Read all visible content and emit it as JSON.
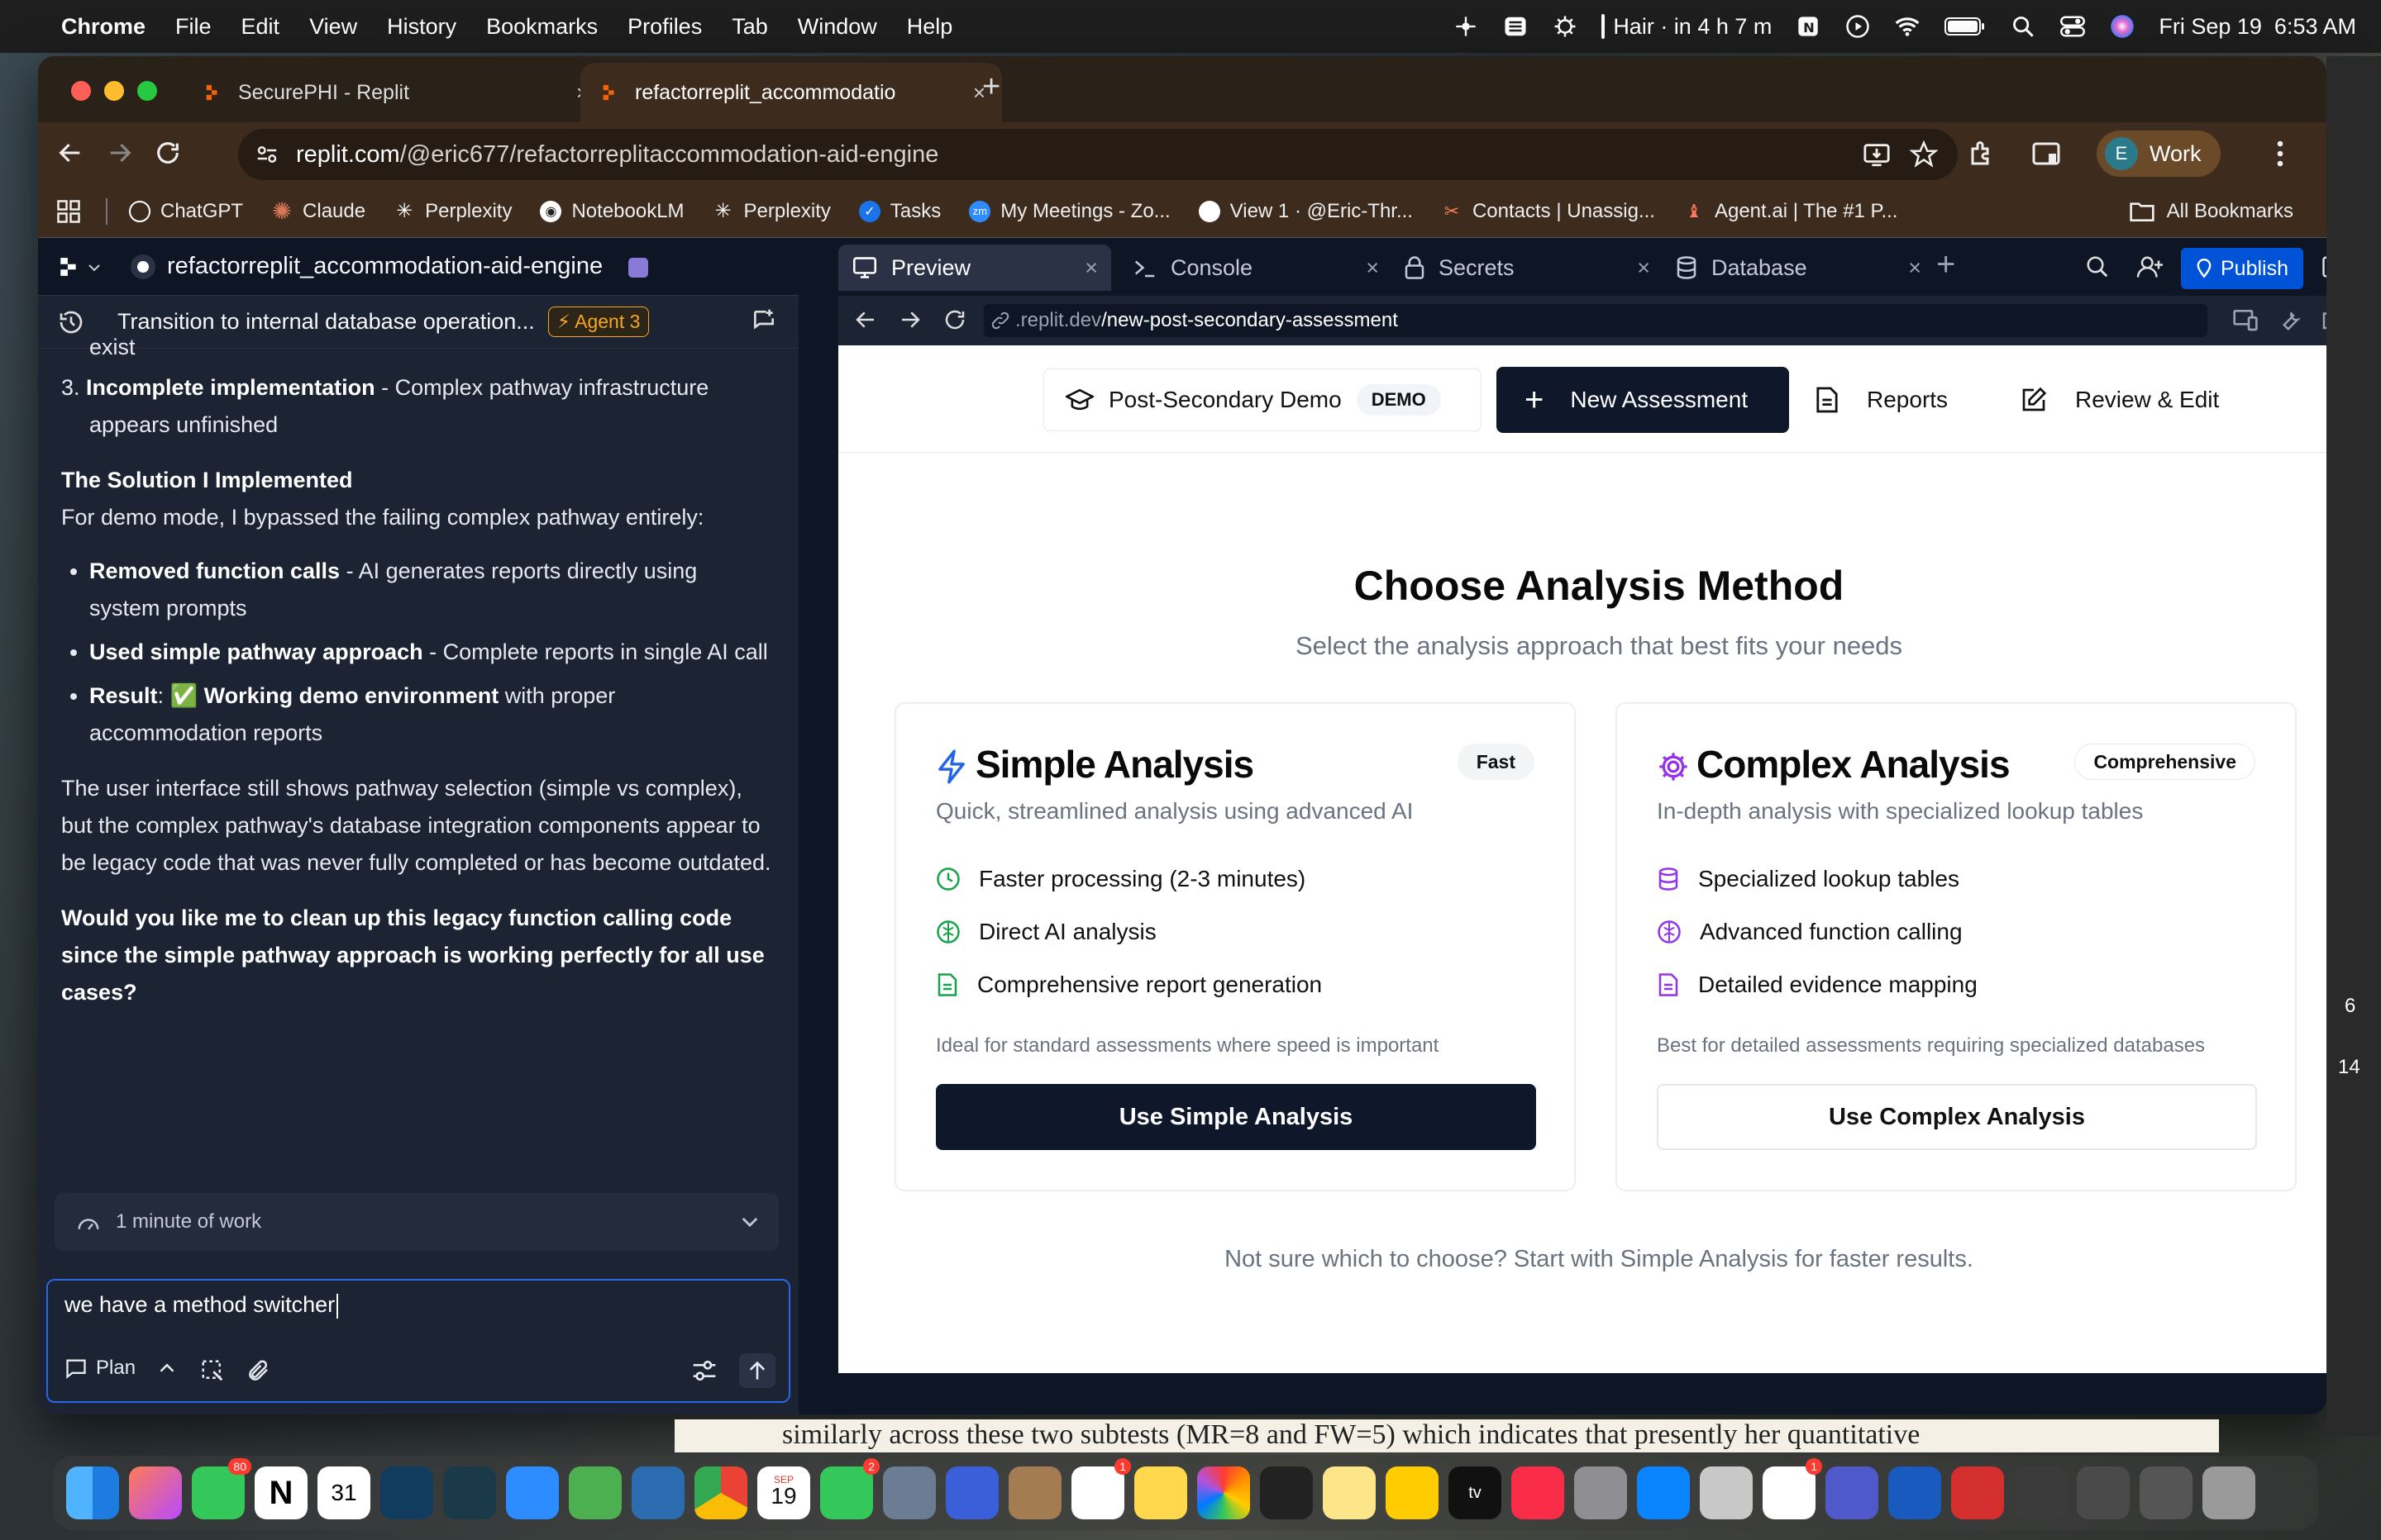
{
  "menubar": {
    "app": "Chrome",
    "items": [
      "File",
      "Edit",
      "View",
      "History",
      "Bookmarks",
      "Profiles",
      "Tab",
      "Window",
      "Help"
    ],
    "status_text": "Hair · in 4 h 7 m",
    "datetime": "Fri Sep 19  6:53 AM"
  },
  "browser": {
    "tabs": [
      {
        "label": "SecurePHI - Replit",
        "active": false
      },
      {
        "label": "refactorreplit_accommodatio",
        "active": true
      }
    ],
    "new_tab": "+",
    "tab_close": "×",
    "url_host": "replit.com",
    "url_path": "/@eric677/refactorreplitaccommodation-aid-engine",
    "profile_initial": "E",
    "profile_label": "Work",
    "bookmarks": [
      {
        "label": "ChatGPT",
        "color": "#ffffff"
      },
      {
        "label": "Claude",
        "color": "#d97757"
      },
      {
        "label": "Perplexity",
        "color": "#ffffff"
      },
      {
        "label": "NotebookLM",
        "color": "#ffffff"
      },
      {
        "label": "Perplexity",
        "color": "#ffffff"
      },
      {
        "label": "Tasks",
        "color": "#1a73e8"
      },
      {
        "label": "My Meetings - Zo...",
        "color": "#2d8cff"
      },
      {
        "label": "View 1 · @Eric-Thr...",
        "color": "#ffffff"
      },
      {
        "label": "Contacts | Unassig...",
        "color": "#ff7a59"
      },
      {
        "label": "Agent.ai | The #1 P...",
        "color": "#ff7a59"
      }
    ],
    "all_bookmarks": "All Bookmarks"
  },
  "replit": {
    "repl_name": "refactorreplit_accommodation-aid-engine",
    "chat_title": "Transition to internal database operation...",
    "agent_badge": "Agent 3",
    "chat": {
      "line_exist": "exist",
      "item3_bold": "Incomplete implementation",
      "item3_rest": " - Complex pathway infrastructure appears unfinished",
      "item3_num": "3.",
      "solution_heading": "The Solution I Implemented",
      "solution_intro": "For demo mode, I bypassed the failing complex pathway entirely:",
      "bullets": [
        {
          "bold": "Removed function calls",
          "rest": " - AI generates reports directly using system prompts"
        },
        {
          "bold": "Used simple pathway approach",
          "rest": " - Complete reports in single AI call"
        },
        {
          "bold": "Result",
          "rest_pre": ": ✅ ",
          "bold2": "Working demo environment",
          "rest": " with proper accommodation reports"
        }
      ],
      "paragraph": "The user interface still shows pathway selection (simple vs complex), but the complex pathway's database integration components appear to be legacy code that was never fully completed or has become outdated.",
      "question": "Would you like me to clean up this legacy function calling code since the simple pathway approach is working perfectly for all use cases?"
    },
    "work_summary": "1 minute of work",
    "input_value": "we have a method switcher",
    "plan_label": "Plan",
    "pane_tabs": [
      {
        "label": "Preview",
        "icon": "monitor-icon",
        "active": true
      },
      {
        "label": "Console",
        "icon": "terminal-icon",
        "active": false
      },
      {
        "label": "Secrets",
        "icon": "lock-icon",
        "active": false
      },
      {
        "label": "Database",
        "icon": "database-icon",
        "active": false
      }
    ],
    "publish_label": "Publish",
    "preview_url_prefix": ".replit.dev",
    "preview_url_path": "/new-post-secondary-assessment"
  },
  "app": {
    "demo_label": "Post-Secondary Demo",
    "demo_badge": "DEMO",
    "new_assessment": "New Assessment",
    "reports": "Reports",
    "review_edit": "Review & Edit",
    "title": "Choose Analysis Method",
    "subtitle": "Select the analysis approach that best fits your needs",
    "simple": {
      "title": "Simple Analysis",
      "badge": "Fast",
      "subtitle": "Quick, streamlined analysis using advanced AI",
      "features": [
        "Faster processing (2-3 minutes)",
        "Direct AI analysis",
        "Comprehensive report generation"
      ],
      "note": "Ideal for standard assessments where speed is important",
      "button": "Use Simple Analysis",
      "accent": "#2563eb",
      "feature_color": "#16a34a"
    },
    "complex": {
      "title": "Complex Analysis",
      "badge": "Comprehensive",
      "subtitle": "In-depth analysis with specialized lookup tables",
      "features": [
        "Specialized lookup tables",
        "Advanced function calling",
        "Detailed evidence mapping"
      ],
      "note": "Best for detailed assessments requiring specialized databases",
      "button": "Use Complex Analysis",
      "accent": "#9333ea"
    },
    "footer_hint": "Not sure which to choose? Start with Simple Analysis for faster results."
  },
  "background_doc_text": "similarly across these two subtests (MR=8 and FW=5) which indicates that presently her quantitative",
  "dock": {
    "messages_badge": "80",
    "calendar_day": "31",
    "date_month": "SEP",
    "date_day": "19",
    "facetime_badge": "2",
    "reminders_badge": "1",
    "slack_badge": "1"
  },
  "side_numbers": [
    "6",
    "14"
  ]
}
